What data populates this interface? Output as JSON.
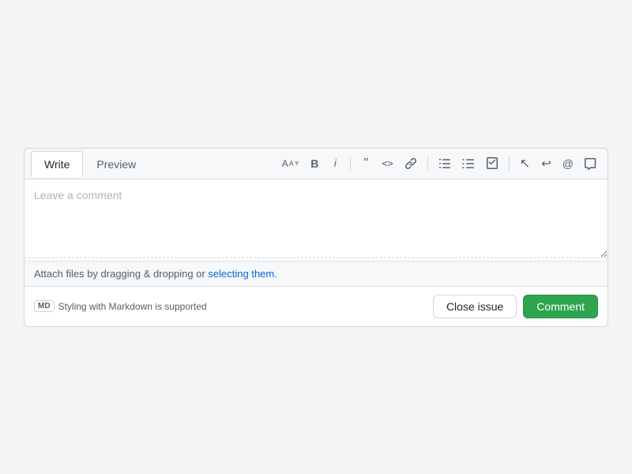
{
  "tabs": [
    {
      "id": "write",
      "label": "Write",
      "active": true
    },
    {
      "id": "preview",
      "label": "Preview",
      "active": false
    }
  ],
  "toolbar": {
    "heading_icon": "AA",
    "bold_icon": "B",
    "italic_icon": "i",
    "quote_icon": "❝",
    "code_icon": "<>",
    "link_icon": "🔗",
    "bullet_list_icon": "≡",
    "numbered_list_icon": "≡#",
    "task_list_icon": "☑",
    "cursor_icon": "↖",
    "reply_icon": "↩",
    "mention_icon": "@",
    "saved_replies_icon": "🔖"
  },
  "textarea": {
    "placeholder": "Leave a comment"
  },
  "attach": {
    "text_before": "Attach files by dragging & dropping or ",
    "link_text": "selecting them",
    "text_after": "."
  },
  "footer": {
    "markdown_badge": "MD",
    "markdown_text": "Styling with Markdown is supported",
    "close_issue_label": "Close issue",
    "comment_label": "Comment"
  }
}
